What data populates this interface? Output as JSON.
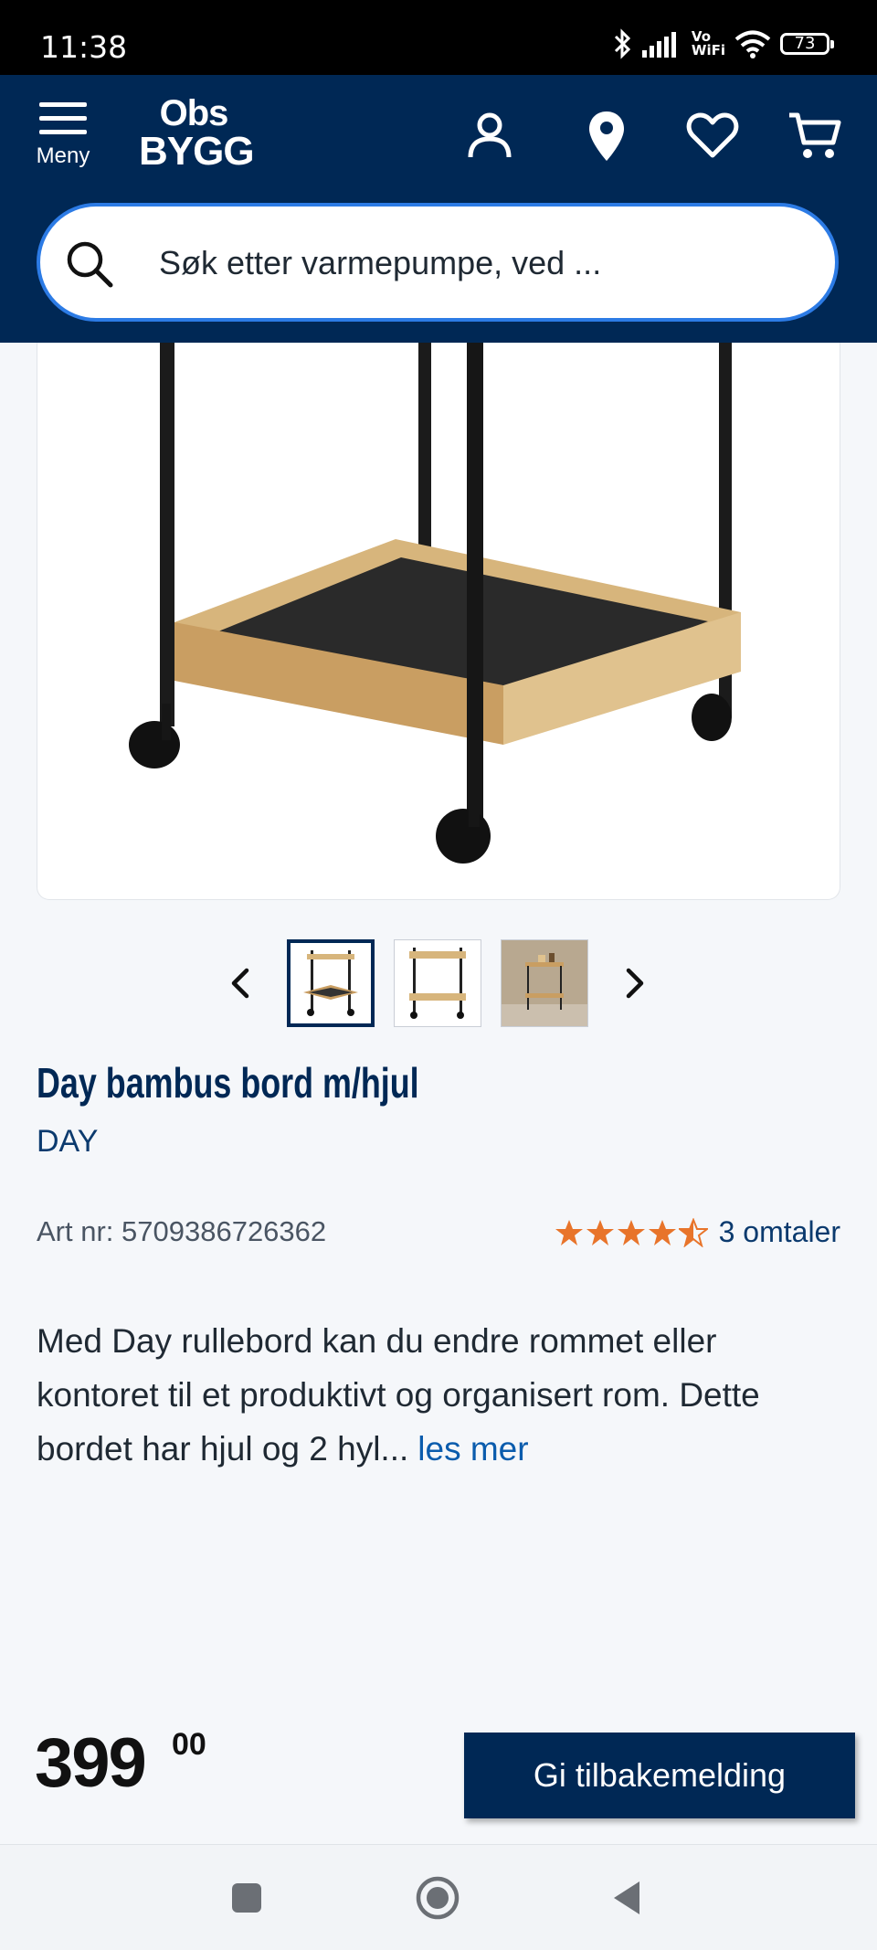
{
  "status_bar": {
    "time": "11:38",
    "vowifi_line1": "Vo",
    "vowifi_line2": "WiFi",
    "battery": "73"
  },
  "header": {
    "menu_label": "Meny",
    "logo_line1": "Obs",
    "logo_line2": "BYGG",
    "brand_color": "#002855"
  },
  "search": {
    "placeholder": "Søk etter varmepumpe, ved ..."
  },
  "product": {
    "title": "Day bambus bord m/hjul",
    "brand": "DAY",
    "article_number": "Art nr: 5709386726362",
    "rating_value": 4.5,
    "rating_max": 5,
    "reviews_label": "3 omtaler",
    "description": "Med Day rullebord kan du endre rommet eller kontoret til et produktivt og organisert rom. Dette bordet har hjul og 2 hyl...",
    "read_more": "les mer",
    "price_main": "399",
    "price_decimals": "00",
    "thumbnail_count": 3,
    "active_thumbnail": 1
  },
  "feedback_button": "Gi tilbakemelding",
  "colors": {
    "accent": "#002855",
    "star": "#e8742a",
    "link": "#0b5cad",
    "search_border": "#2c7be5"
  }
}
